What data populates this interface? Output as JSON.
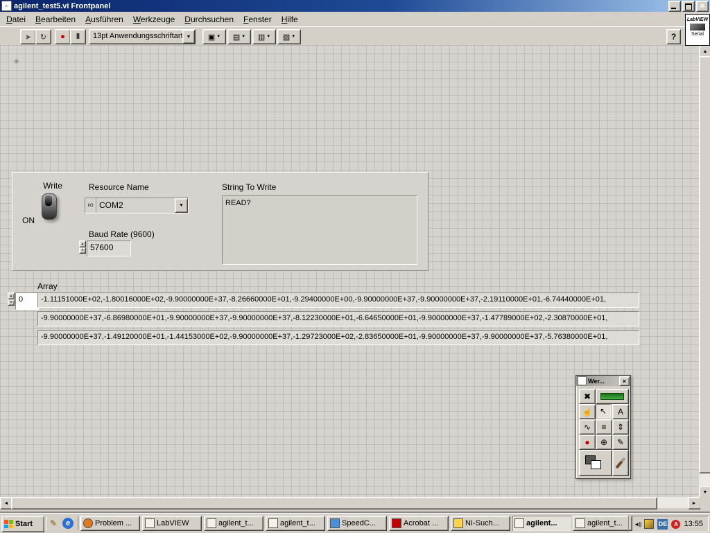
{
  "window": {
    "title": "agilent_test5.vi Frontpanel",
    "badge_line1": "LabVIEW",
    "badge_line2": "Serial"
  },
  "menu": {
    "items": [
      "Datei",
      "Bearbeiten",
      "Ausführen",
      "Werkzeuge",
      "Durchsuchen",
      "Fenster",
      "Hilfe"
    ]
  },
  "toolbar": {
    "font_selector": "13pt Anwendungsschriftart",
    "help_label": "?"
  },
  "icons": {
    "run": "➤",
    "run_continuous": "↻",
    "abort": "●",
    "pause": "‖",
    "align": "▣",
    "distribute": "▤",
    "resize": "▥",
    "reorder": "▧",
    "arrow_down": "▼",
    "arrow_up": "▲",
    "arrow_left": "◄",
    "arrow_right": "►",
    "close": "×",
    "volume": "◄))",
    "origin_marker": "◈",
    "window_glyph": "➢"
  },
  "panel": {
    "write": {
      "label": "Write",
      "state": "ON"
    },
    "resource": {
      "label": "Resource Name",
      "io_glyph": "I/O",
      "value": "COM2"
    },
    "baud": {
      "label": "Baud Rate (9600)",
      "value": "57600"
    },
    "string_to_write": {
      "label": "String To Write",
      "value": "READ?"
    }
  },
  "array": {
    "label": "Array",
    "index_value": "0",
    "rows": [
      "-1.11151000E+02,-1.80016000E+02,-9.90000000E+37,-8.26660000E+01,-9.29400000E+00,-9.90000000E+37,-9.90000000E+37,-2.19110000E+01,-6.74440000E+01,",
      "-9.90000000E+37,-6.86980000E+01,-9.90000000E+37,-9.90000000E+37,-8.12230000E+01,-6.64650000E+01,-9.90000000E+37,-1.47789000E+02,-2.30870000E+01,",
      "-9.90000000E+37,-1.49120000E+01,-1.44153000E+02,-9.90000000E+37,-1.29723000E+02,-2.83650000E+01,-9.90000000E+37,-9.90000000E+37,-5.76380000E+01,"
    ]
  },
  "palette": {
    "title": "Wer...",
    "tools": {
      "auto": "✖",
      "operate": "☝",
      "position": "↖",
      "edit": "A",
      "wire": "∿",
      "object_menu": "≡",
      "scroll": "⇕",
      "breakpoint": "●",
      "probe": "⊕",
      "color_copy": "✎"
    }
  },
  "taskbar": {
    "start_label": "Start",
    "tasks": [
      {
        "label": "Problem ..."
      },
      {
        "label": "LabVIEW"
      },
      {
        "label": "agilent_t..."
      },
      {
        "label": "agilent_t..."
      },
      {
        "label": "SpeedC..."
      },
      {
        "label": "Acrobat ..."
      },
      {
        "label": "NI-Such..."
      },
      {
        "label": "agilent..."
      },
      {
        "label": "agilent_t..."
      }
    ],
    "tray": {
      "lang": "DE",
      "time": "13:55"
    }
  },
  "colors": {
    "titlebar_left": "#0a246a",
    "titlebar_right": "#a6caf0",
    "chrome": "#d4d0c8",
    "abort_red": "#cc0000",
    "led_green": "#2e9e3f"
  }
}
